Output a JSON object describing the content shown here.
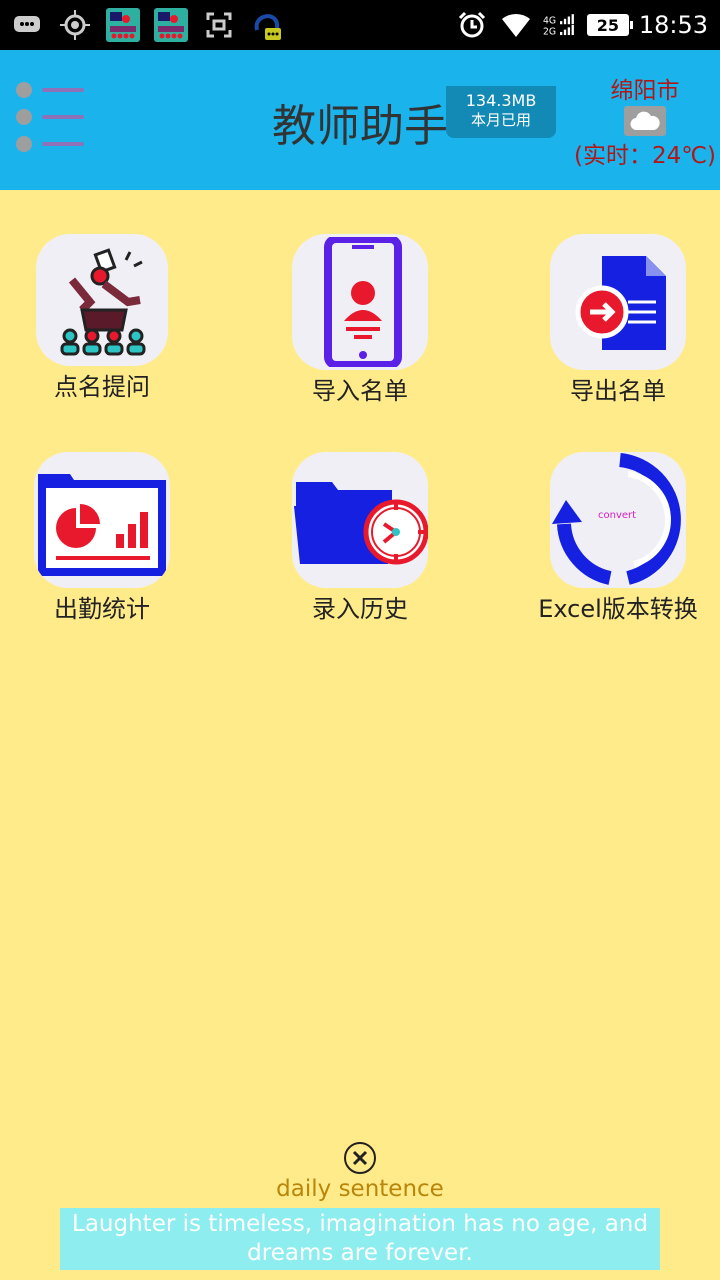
{
  "status_bar": {
    "time": "18:53",
    "battery": "25",
    "icons": [
      "message-icon",
      "location-icon",
      "app-thumb-icon",
      "app-thumb-icon",
      "screenshot-icon",
      "chat-bot-icon",
      "alarm-icon",
      "wifi-icon",
      "signal-4g-icon",
      "signal-2g-icon"
    ]
  },
  "header": {
    "title": "教师助手",
    "usage": {
      "value": "134.3MB",
      "label": "本月已用"
    },
    "weather": {
      "city": "绵阳市",
      "icon": "cloud-icon",
      "temp": "(实时：24℃)"
    }
  },
  "tiles": [
    {
      "label": "点名提问",
      "icon": "roll-call-icon"
    },
    {
      "label": "导入名单",
      "icon": "phone-contact-icon"
    },
    {
      "label": "导出名单",
      "icon": "export-document-icon"
    },
    {
      "label": "出勤统计",
      "icon": "attendance-chart-icon"
    },
    {
      "label": "录入历史",
      "icon": "folder-clock-icon"
    },
    {
      "label": "Excel版本转换",
      "icon": "convert-icon",
      "icon_text": "convert"
    }
  ],
  "daily": {
    "close_icon": "close-circle-icon",
    "title": "daily sentence",
    "sentence": "Laughter is timeless, imagination has no age, and dreams are forever."
  },
  "colors": {
    "header_bg": "#1AB3EC",
    "page_bg": "#FFEB8A",
    "weather_text": "#B01818",
    "daily_title": "#B8860B",
    "daily_box": "#8DEDEF",
    "accent_blue": "#1520E0",
    "accent_red": "#E8192C"
  }
}
